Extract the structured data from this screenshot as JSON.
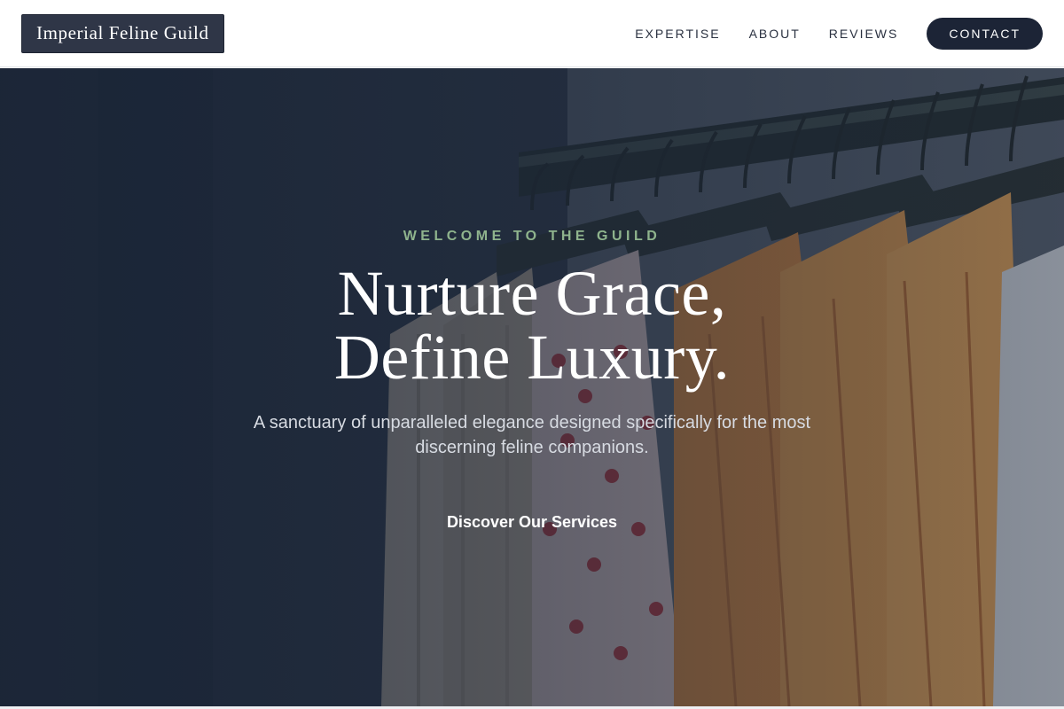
{
  "header": {
    "logo_text": "Imperial Feline Guild",
    "nav": [
      {
        "label": "EXPERTISE"
      },
      {
        "label": "ABOUT"
      },
      {
        "label": "REVIEWS"
      }
    ],
    "contact_label": "CONTACT"
  },
  "hero": {
    "eyebrow": "WELCOME TO THE GUILD",
    "headline_line1": "Nurture Grace,",
    "headline_line2": "Define Luxury.",
    "subtext": "A sanctuary of unparalleled elegance designed specifically for the most discerning feline companions.",
    "cta_label": "Discover Our Services",
    "background_image": "clothing-rack-photo"
  },
  "colors": {
    "brand_dark": "#1c2436",
    "accent_green": "#8fb48d",
    "logo_bg": "#2f3647"
  }
}
